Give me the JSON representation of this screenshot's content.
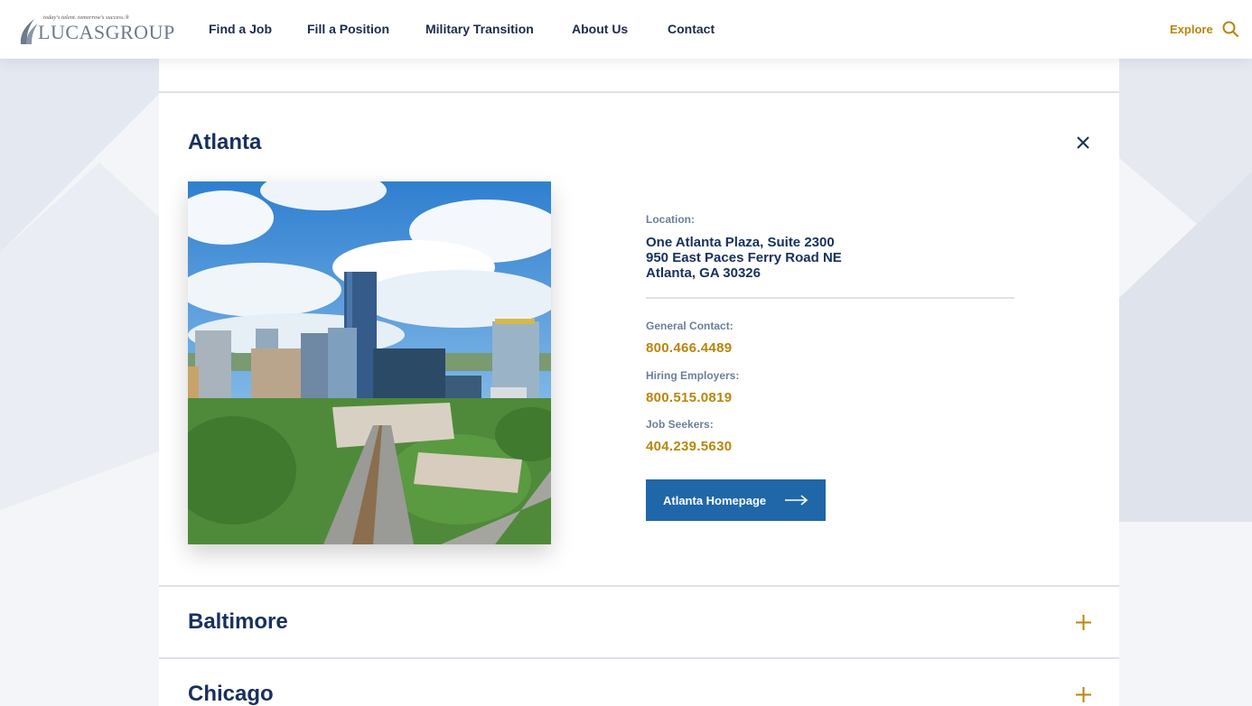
{
  "header": {
    "logo_tagline": "today's talent. tomorrow's success.®",
    "logo_text": "LUCASGROUP",
    "nav": [
      "Find a Job",
      "Fill a Position",
      "Military Transition",
      "About Us",
      "Contact"
    ],
    "explore_label": "Explore"
  },
  "icons": {
    "search": "search-icon",
    "close": "close-icon",
    "expand": "plus-icon",
    "arrow": "arrow-right-icon"
  },
  "colors": {
    "navy": "#17305e",
    "gold": "#b8860b",
    "button_blue": "#1f67a8",
    "label_gray": "#6b7f99"
  },
  "offices": {
    "expanded": {
      "city": "Atlanta",
      "location_label": "Location:",
      "address": [
        "One Atlanta Plaza, Suite 2300",
        "950 East Paces Ferry Road NE",
        "Atlanta, GA 30326"
      ],
      "contacts": [
        {
          "label": "General Contact:",
          "phone": "800.466.4489"
        },
        {
          "label": "Hiring Employers:",
          "phone": "800.515.0819"
        },
        {
          "label": "Job Seekers:",
          "phone": "404.239.5630"
        }
      ],
      "button_label": "Atlanta Homepage"
    },
    "collapsed": [
      "Baltimore",
      "Chicago"
    ]
  }
}
